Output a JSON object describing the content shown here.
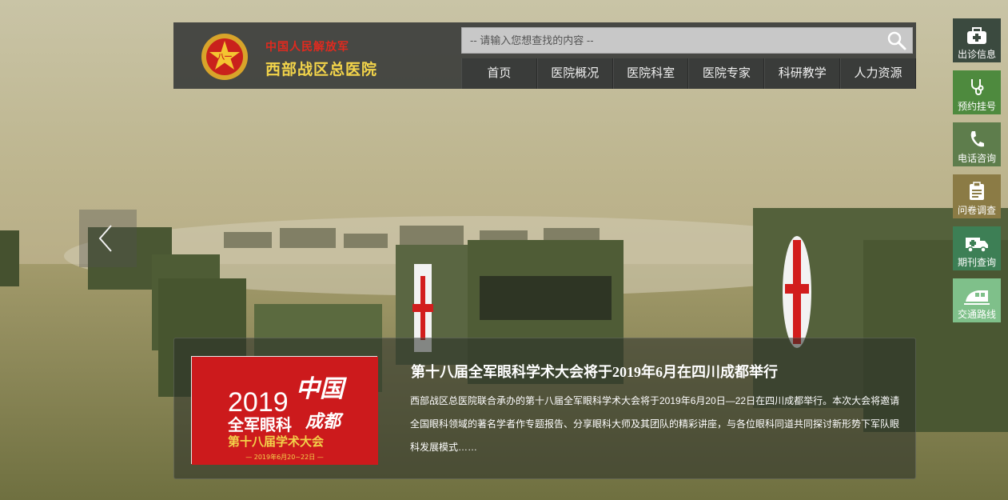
{
  "site": {
    "org_sub": "中国人民解放军",
    "org_main": "西部战区总医院"
  },
  "search": {
    "placeholder": "-- 请输入您想查找的内容 --"
  },
  "nav": {
    "items": [
      "首页",
      "医院概况",
      "医院科室",
      "医院专家",
      "科研教学",
      "人力资源"
    ]
  },
  "sidebar": {
    "items": [
      {
        "label": "出诊信息",
        "icon": "medical-kit-icon",
        "color": "#3b4a3f"
      },
      {
        "label": "预约挂号",
        "icon": "stethoscope-icon",
        "color": "#4e8a3e"
      },
      {
        "label": "电话咨询",
        "icon": "phone-icon",
        "color": "#5e7d4c"
      },
      {
        "label": "问卷调查",
        "icon": "clipboard-icon",
        "color": "#8b7b45"
      },
      {
        "label": "期刊查询",
        "icon": "ambulance-icon",
        "color": "#3d7f55"
      },
      {
        "label": "交通路线",
        "icon": "train-icon",
        "color": "#7fc08a"
      }
    ]
  },
  "news": {
    "title": "第十八届全军眼科学术大会将于2019年6月在四川成都举行",
    "description": "西部战区总医院联合承办的第十八届全军眼科学术大会将于2019年6月20日—22日在四川成都举行。本次大会将邀请全国眼科领域的著名学者作专题报告、分享眼科大师及其团队的精彩讲座，与各位眼科同道共同探讨新形势下军队眼科发展模式……",
    "image": {
      "year": "2019",
      "calligraphy_1": "中国",
      "calligraphy_2": "成都",
      "line1": "全军眼科",
      "line2": "第十八届学术大会",
      "date": "— 2019年6月20~22日 —"
    }
  },
  "colors": {
    "header_bg": "#3c3e3c",
    "logo_red": "#e02a1f",
    "logo_gold": "#f3d44a",
    "news_image_red": "#cc1a1c"
  }
}
